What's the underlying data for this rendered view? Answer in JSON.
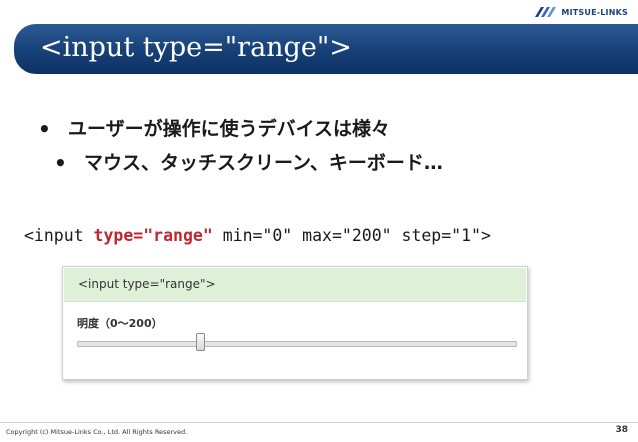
{
  "header": {
    "logo_text": "MITSUE-LINKS",
    "logo_icon": "mitsue-links-logo-icon"
  },
  "title": "<input type=\"range\">",
  "bullets": [
    {
      "level": 1,
      "text": "ユーザーが操作に使うデバイスは様々"
    },
    {
      "level": 2,
      "text": "マウス、タッチスクリーン、キーボード…"
    }
  ],
  "code": {
    "prefix": "<input ",
    "highlight": "type=\"range\"",
    "suffix": " min=\"0\" max=\"200\" step=\"1\">"
  },
  "demo": {
    "header": "<input type=\"range\">",
    "label": "明度（0～200）",
    "range": {
      "min": 0,
      "max": 200,
      "step": 1,
      "value": 56
    }
  },
  "footer": {
    "copyright": "Copyright (c)  Mitsue-Links Co., Ltd. All Rights Reserved.",
    "page": "38"
  },
  "colors": {
    "title_bar": "#164077",
    "highlight": "#c0262d",
    "demo_header_bg": "#dff0d8"
  }
}
